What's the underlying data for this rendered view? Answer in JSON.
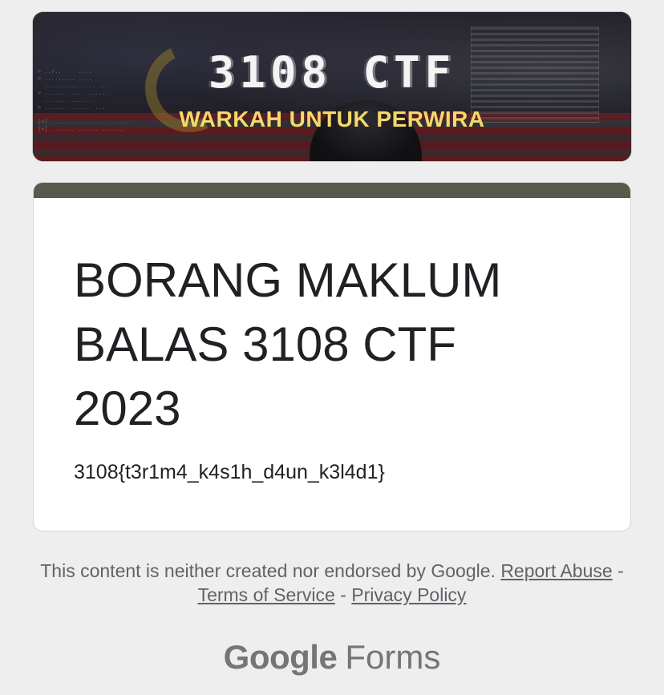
{
  "header": {
    "banner_title": "3108 CTF",
    "banner_subtitle": "WARKAH UNTUK PERWIRA"
  },
  "form": {
    "title": "BORANG MAKLUM BALAS 3108 CTF 2023",
    "description": "3108{t3r1m4_k4s1h_d4un_k3l4d1}",
    "accent_color": "#575a4b"
  },
  "footer": {
    "disclaimer": "This content is neither created nor endorsed by Google.",
    "links": {
      "report_abuse": "Report Abuse",
      "terms": "Terms of Service",
      "privacy": "Privacy Policy"
    },
    "separator": "-",
    "brand_google": "Google",
    "brand_forms": "Forms"
  },
  "colors": {
    "page_background": "#eeeeee",
    "banner_subtitle": "#f6d86a"
  }
}
